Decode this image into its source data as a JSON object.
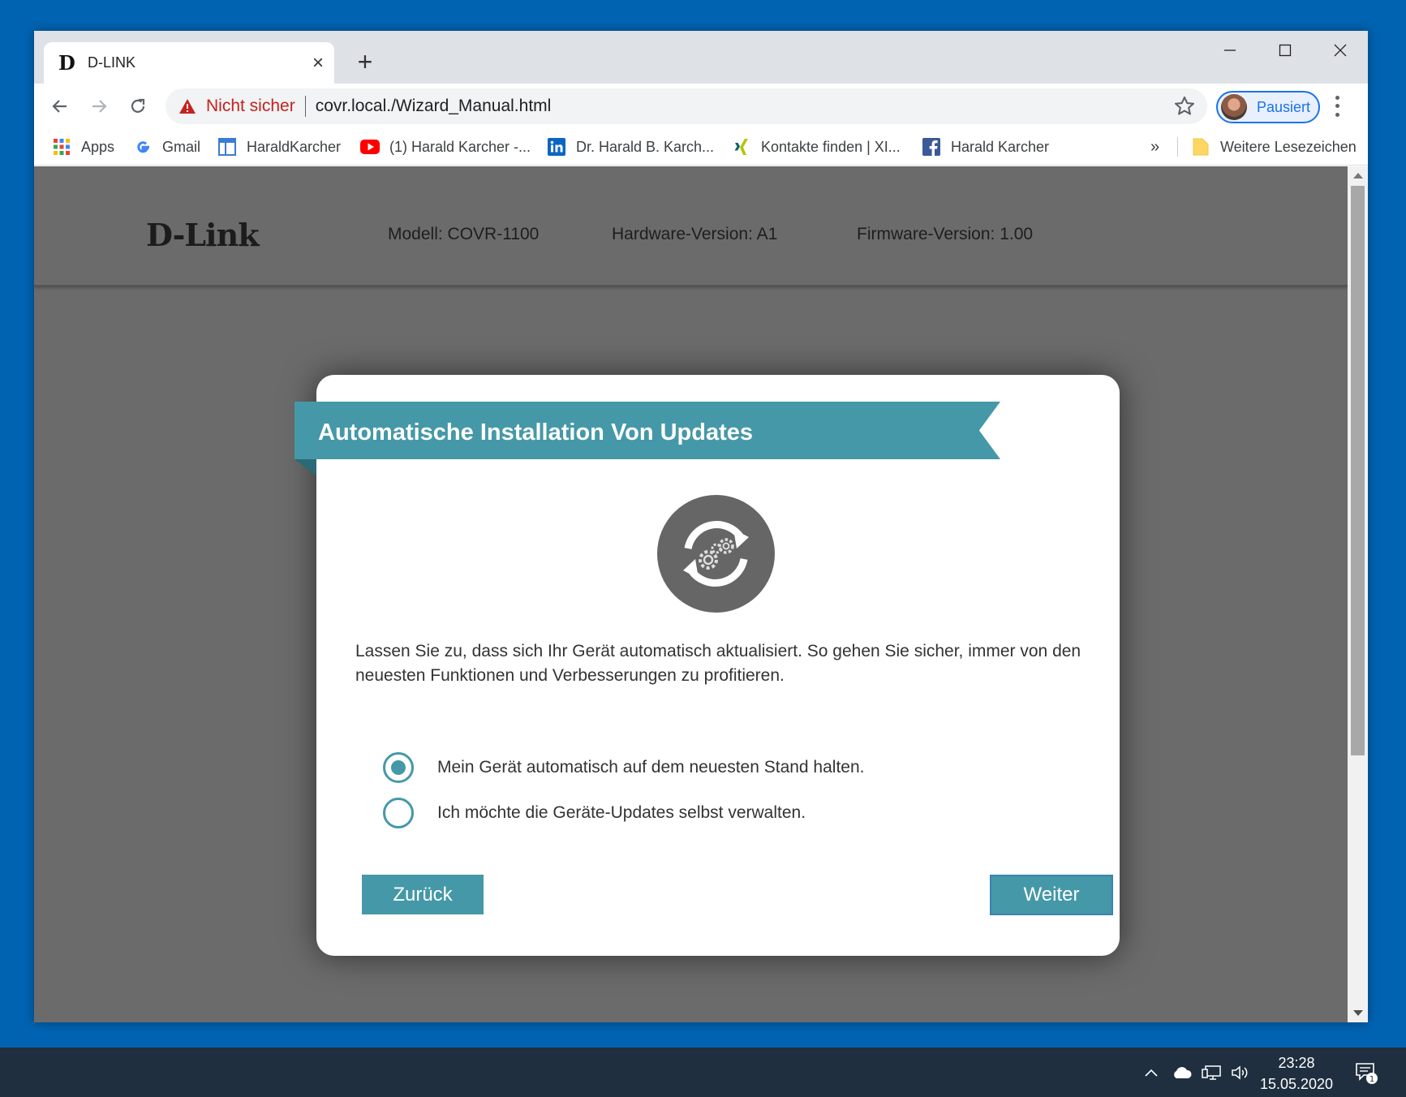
{
  "browser": {
    "tab": {
      "favicon": "D",
      "title": "D-LINK"
    },
    "new_tab_label": "+",
    "omnibox": {
      "security_label": "Nicht sicher",
      "url": "covr.local./Wizard_Manual.html"
    },
    "profile": {
      "label": "Pausiert"
    },
    "bookmarks": [
      {
        "label": "Apps",
        "icon": "apps-grid-icon"
      },
      {
        "label": "Gmail",
        "icon": "google-icon"
      },
      {
        "label": "HaraldKarcher",
        "icon": "page-icon"
      },
      {
        "label": "(1) Harald Karcher -...",
        "icon": "youtube-icon"
      },
      {
        "label": "Dr. Harald B. Karch...",
        "icon": "linkedin-icon"
      },
      {
        "label": "Kontakte finden | XI...",
        "icon": "xing-icon"
      },
      {
        "label": "Harald Karcher",
        "icon": "facebook-icon"
      }
    ],
    "bookmarks_more": "»",
    "other_bookmarks": "Weitere Lesezeichen"
  },
  "page": {
    "brand": "D-Link",
    "model": "Modell: COVR-1100",
    "hardware": "Hardware-Version: A1",
    "firmware": "Firmware-Version: 1.00"
  },
  "modal": {
    "title": "Automatische Installation Von Updates",
    "description": "Lassen Sie zu, dass sich Ihr Gerät automatisch aktualisiert. So gehen Sie sicher, immer von den neuesten Funktionen und Verbesserungen zu profitieren.",
    "options": [
      {
        "label": "Mein Gerät automatisch auf dem neuesten Stand halten.",
        "selected": true
      },
      {
        "label": "Ich möchte die Geräte-Updates selbst verwalten.",
        "selected": false
      }
    ],
    "back_label": "Zurück",
    "next_label": "Weiter"
  },
  "taskbar": {
    "time": "23:28",
    "date": "15.05.2020",
    "notification_count": "1"
  },
  "colors": {
    "accent": "#4598a8",
    "desktop": "#0063b1",
    "taskbar": "#1f2f3f",
    "page_bg": "#6b6b6b"
  }
}
